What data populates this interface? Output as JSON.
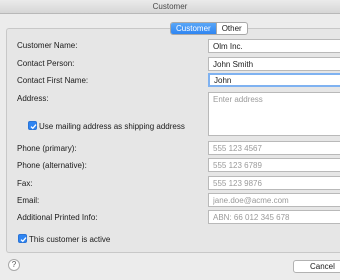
{
  "window": {
    "title": "Customer"
  },
  "tabs": [
    {
      "label": "Customer",
      "active": true
    },
    {
      "label": "Other",
      "active": false
    }
  ],
  "form": {
    "customer_name": {
      "label": "Customer Name:",
      "value": "Olm Inc."
    },
    "contact_person": {
      "label": "Contact Person:",
      "value": "John Smith"
    },
    "contact_first_name": {
      "label": "Contact First Name:",
      "value": "John"
    },
    "address": {
      "label": "Address:",
      "placeholder": "Enter address"
    },
    "mailing_checkbox": {
      "label": "Use mailing address as shipping address",
      "checked": true
    },
    "phone_primary": {
      "label": "Phone (primary):",
      "placeholder": "555 123 4567"
    },
    "phone_alt": {
      "label": "Phone (alternative):",
      "placeholder": "555 123 6789"
    },
    "fax": {
      "label": "Fax:",
      "placeholder": "555 123 9876"
    },
    "email": {
      "label": "Email:",
      "placeholder": "jane.doe@acme.com"
    },
    "printed_info": {
      "label": "Additional Printed Info:",
      "placeholder": "ABN: 66 012 345 678"
    },
    "active_checkbox": {
      "label": "This customer is active",
      "checked": true
    }
  },
  "footer": {
    "help_label": "?",
    "cancel_label": "Cancel"
  },
  "colors": {
    "accent": "#2f85f2",
    "background": "#ececec",
    "focus_ring": "#7fb2f1"
  }
}
